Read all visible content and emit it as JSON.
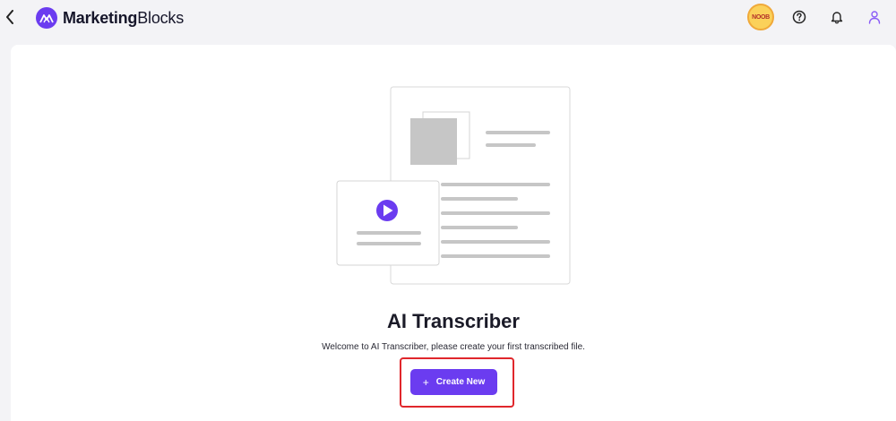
{
  "header": {
    "brand_bold": "Marketing",
    "brand_light": "Blocks",
    "badge_text": "NOOB",
    "icons": [
      "back-chevron-icon",
      "help-icon",
      "bell-icon",
      "user-icon"
    ]
  },
  "main": {
    "title": "AI Transcriber",
    "subtitle": "Welcome to AI Transcriber, please create your first transcribed file.",
    "create_button_plus": "+",
    "create_button_label": "Create New"
  },
  "colors": {
    "accent": "#6b3cf0",
    "highlight": "#e0272c",
    "page_bg": "#f3f3f6"
  }
}
